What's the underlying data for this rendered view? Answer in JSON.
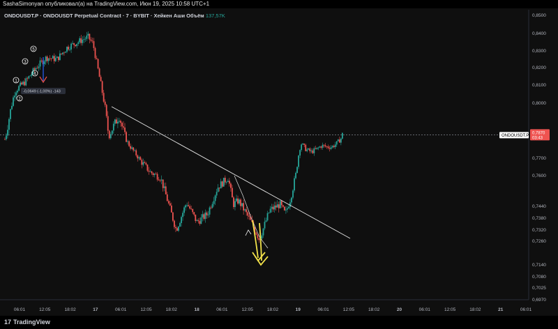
{
  "header": {
    "published_by": "SashaSimonyan опубликовал(а) на TradingView.com, Июн 19, 2025 10:58 UTC+1"
  },
  "legend": {
    "symbol": "ONDOUSDT.P · ONDOUSDT Perpetual Contract · 7 · BYBIT · Хейкен Аши",
    "volume_label": "Объём",
    "volume_value": "137,57K"
  },
  "footer": {
    "brand": "TradingView",
    "brand_mark": "17"
  },
  "colors": {
    "bull": "#26a69a",
    "bear": "#ef5350",
    "trendline": "#e6e6e6",
    "price_tag": "#ef5350",
    "arrow": "#f3e24a"
  },
  "chart_data": {
    "type": "candlestick",
    "style": "heikin-ashi",
    "interval": "7",
    "y_ticks": [
      0.85,
      0.84,
      0.83,
      0.82,
      0.81,
      0.8,
      0.786,
      0.77,
      0.76,
      0.744,
      0.738,
      0.732,
      0.726,
      0.714,
      0.708,
      0.7025,
      0.697
    ],
    "y_tick_labels": [
      "0,8500",
      "0,8400",
      "0,8300",
      "0,8200",
      "0,8100",
      "0,8000",
      "0,7860",
      "0,7700",
      "0,7600",
      "0,7440",
      "0,7380",
      "0,7320",
      "0,7260",
      "0,7140",
      "0,7080",
      "0,7025",
      "0,6970"
    ],
    "x_ticks": [
      "06:01",
      "12:05",
      "18:02",
      "17",
      "06:01",
      "12:05",
      "18:02",
      "18",
      "06:01",
      "12:05",
      "18:02",
      "19",
      "06:01",
      "12:05",
      "18:02",
      "20",
      "06:01",
      "12:05",
      "18:02",
      "21",
      "06:01"
    ],
    "current_price": "0,7870",
    "current_price_countdown": "03:43",
    "current_symbol_tag": "ONDOUSDT.P",
    "path": [
      [
        0,
        0.785
      ],
      [
        2,
        0.807
      ],
      [
        4,
        0.812
      ],
      [
        6,
        0.82
      ],
      [
        8,
        0.826
      ],
      [
        10,
        0.825
      ],
      [
        12,
        0.832
      ],
      [
        14,
        0.835
      ],
      [
        16,
        0.838
      ],
      [
        17,
        0.834
      ],
      [
        18,
        0.818
      ],
      [
        20,
        0.787
      ],
      [
        22,
        0.795
      ],
      [
        24,
        0.78
      ],
      [
        26,
        0.769
      ],
      [
        28,
        0.762
      ],
      [
        30,
        0.759
      ],
      [
        32,
        0.741
      ],
      [
        33,
        0.732
      ],
      [
        35,
        0.746
      ],
      [
        37,
        0.736
      ],
      [
        39,
        0.74
      ],
      [
        41,
        0.754
      ],
      [
        43,
        0.759
      ],
      [
        44,
        0.745
      ],
      [
        45,
        0.747
      ],
      [
        47,
        0.738
      ],
      [
        48,
        0.733
      ],
      [
        49,
        0.727
      ],
      [
        51,
        0.742
      ],
      [
        53,
        0.745
      ],
      [
        54,
        0.74
      ],
      [
        55,
        0.748
      ],
      [
        56,
        0.76
      ],
      [
        57,
        0.782
      ],
      [
        58,
        0.777
      ],
      [
        59,
        0.775
      ],
      [
        60,
        0.777
      ],
      [
        61,
        0.78
      ],
      [
        62,
        0.779
      ],
      [
        63,
        0.779
      ],
      [
        64,
        0.782
      ],
      [
        65,
        0.787
      ]
    ],
    "annotations": {
      "wave_labels": [
        "1",
        "2",
        "3",
        "4",
        "5"
      ],
      "measure_label": "-0,0649 (-1,00%) -143"
    }
  }
}
